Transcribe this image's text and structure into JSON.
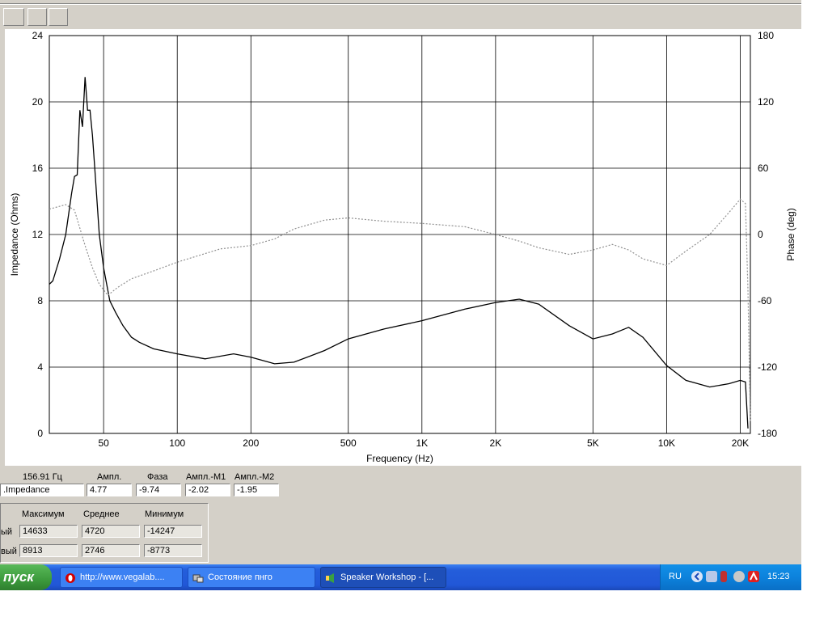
{
  "chart_data": {
    "type": "line",
    "xlabel": "Frequency (Hz)",
    "ylabel": "Impedance (Ohms)",
    "y2label": "Phase (deg)",
    "x_scale": "log",
    "xlim": [
      30,
      22000
    ],
    "ylim": [
      0,
      24
    ],
    "y2lim": [
      -180,
      180
    ],
    "x_ticks": [
      50,
      100,
      200,
      500,
      1000,
      2000,
      5000,
      10000,
      20000
    ],
    "x_tick_labels": [
      "50",
      "100",
      "200",
      "500",
      "1K",
      "2K",
      "5K",
      "10K",
      "20K"
    ],
    "y_ticks": [
      0,
      4,
      8,
      12,
      16,
      20,
      24
    ],
    "y_tick_labels": [
      "0",
      "4",
      "8",
      "12",
      "16",
      "20",
      "24"
    ],
    "y2_ticks": [
      -180,
      -120,
      -60,
      0,
      60,
      120,
      180
    ],
    "y2_tick_labels": [
      "-180",
      "-120",
      "-60",
      "0",
      "60",
      "120",
      "180"
    ],
    "grid": true,
    "series": [
      {
        "axis": "left",
        "style": "solid",
        "color": "#000000",
        "points": [
          [
            30,
            9
          ],
          [
            31,
            9.2
          ],
          [
            33,
            10.5
          ],
          [
            35,
            12
          ],
          [
            37,
            14.5
          ],
          [
            38,
            15.5
          ],
          [
            39,
            15.6
          ],
          [
            40,
            19.5
          ],
          [
            41,
            18.5
          ],
          [
            42,
            21.5
          ],
          [
            43,
            19.5
          ],
          [
            44,
            19.5
          ],
          [
            45,
            18
          ],
          [
            46,
            16
          ],
          [
            47,
            14
          ],
          [
            48,
            12
          ],
          [
            50,
            10
          ],
          [
            53,
            8
          ],
          [
            56,
            7.3
          ],
          [
            60,
            6.5
          ],
          [
            65,
            5.8
          ],
          [
            70,
            5.5
          ],
          [
            80,
            5.1
          ],
          [
            100,
            4.8
          ],
          [
            130,
            4.5
          ],
          [
            170,
            4.8
          ],
          [
            200,
            4.6
          ],
          [
            250,
            4.2
          ],
          [
            300,
            4.3
          ],
          [
            400,
            5
          ],
          [
            500,
            5.7
          ],
          [
            700,
            6.3
          ],
          [
            1000,
            6.8
          ],
          [
            1500,
            7.5
          ],
          [
            2000,
            7.9
          ],
          [
            2500,
            8.1
          ],
          [
            3000,
            7.8
          ],
          [
            4000,
            6.5
          ],
          [
            5000,
            5.7
          ],
          [
            6000,
            6
          ],
          [
            7000,
            6.4
          ],
          [
            8000,
            5.8
          ],
          [
            10000,
            4.1
          ],
          [
            12000,
            3.2
          ],
          [
            15000,
            2.8
          ],
          [
            18000,
            3
          ],
          [
            20000,
            3.2
          ],
          [
            21000,
            3.1
          ],
          [
            21500,
            0.3
          ]
        ]
      },
      {
        "axis": "right",
        "style": "dotted",
        "color": "#909090",
        "points": [
          [
            30,
            23
          ],
          [
            35,
            27
          ],
          [
            38,
            22
          ],
          [
            42,
            -10
          ],
          [
            45,
            -30
          ],
          [
            48,
            -45
          ],
          [
            52,
            -55
          ],
          [
            57,
            -48
          ],
          [
            65,
            -40
          ],
          [
            80,
            -33
          ],
          [
            100,
            -25
          ],
          [
            150,
            -13
          ],
          [
            200,
            -10
          ],
          [
            250,
            -4
          ],
          [
            300,
            5
          ],
          [
            400,
            13
          ],
          [
            500,
            15
          ],
          [
            700,
            12
          ],
          [
            1000,
            10
          ],
          [
            1500,
            7
          ],
          [
            2000,
            0
          ],
          [
            2500,
            -6
          ],
          [
            3000,
            -12
          ],
          [
            4000,
            -18
          ],
          [
            5000,
            -14
          ],
          [
            6000,
            -9
          ],
          [
            7000,
            -14
          ],
          [
            8000,
            -22
          ],
          [
            10000,
            -28
          ],
          [
            12000,
            -15
          ],
          [
            15000,
            0
          ],
          [
            18000,
            20
          ],
          [
            20000,
            32
          ],
          [
            21000,
            28
          ],
          [
            21500,
            -50
          ],
          [
            22000,
            -170
          ]
        ]
      }
    ]
  },
  "readout": {
    "freq": "156.91 Гц",
    "col_amp": "Ампл.",
    "col_phase": "Фаза",
    "col_m1": "Ампл.-М1",
    "col_m2": "Ампл.-М2",
    "trace_name": ".Impedance",
    "amp": "4.77",
    "phase": "-9.74",
    "m1": "-2.02",
    "m2": "-1.95"
  },
  "stats": {
    "col_max": "Максимум",
    "col_avg": "Среднее",
    "col_min": "Минимум",
    "rows": [
      {
        "label": "ый",
        "max": "14633",
        "avg": "4720",
        "min": "-14247"
      },
      {
        "label": "вый",
        "max": "8913",
        "avg": "2746",
        "min": "-8773"
      }
    ]
  },
  "taskbar": {
    "start": "пуск",
    "tasks": [
      "http://www.vegalab....",
      "Состояние пнго",
      "Speaker Workshop - [..."
    ],
    "lang": "RU",
    "clock": "15:23"
  }
}
